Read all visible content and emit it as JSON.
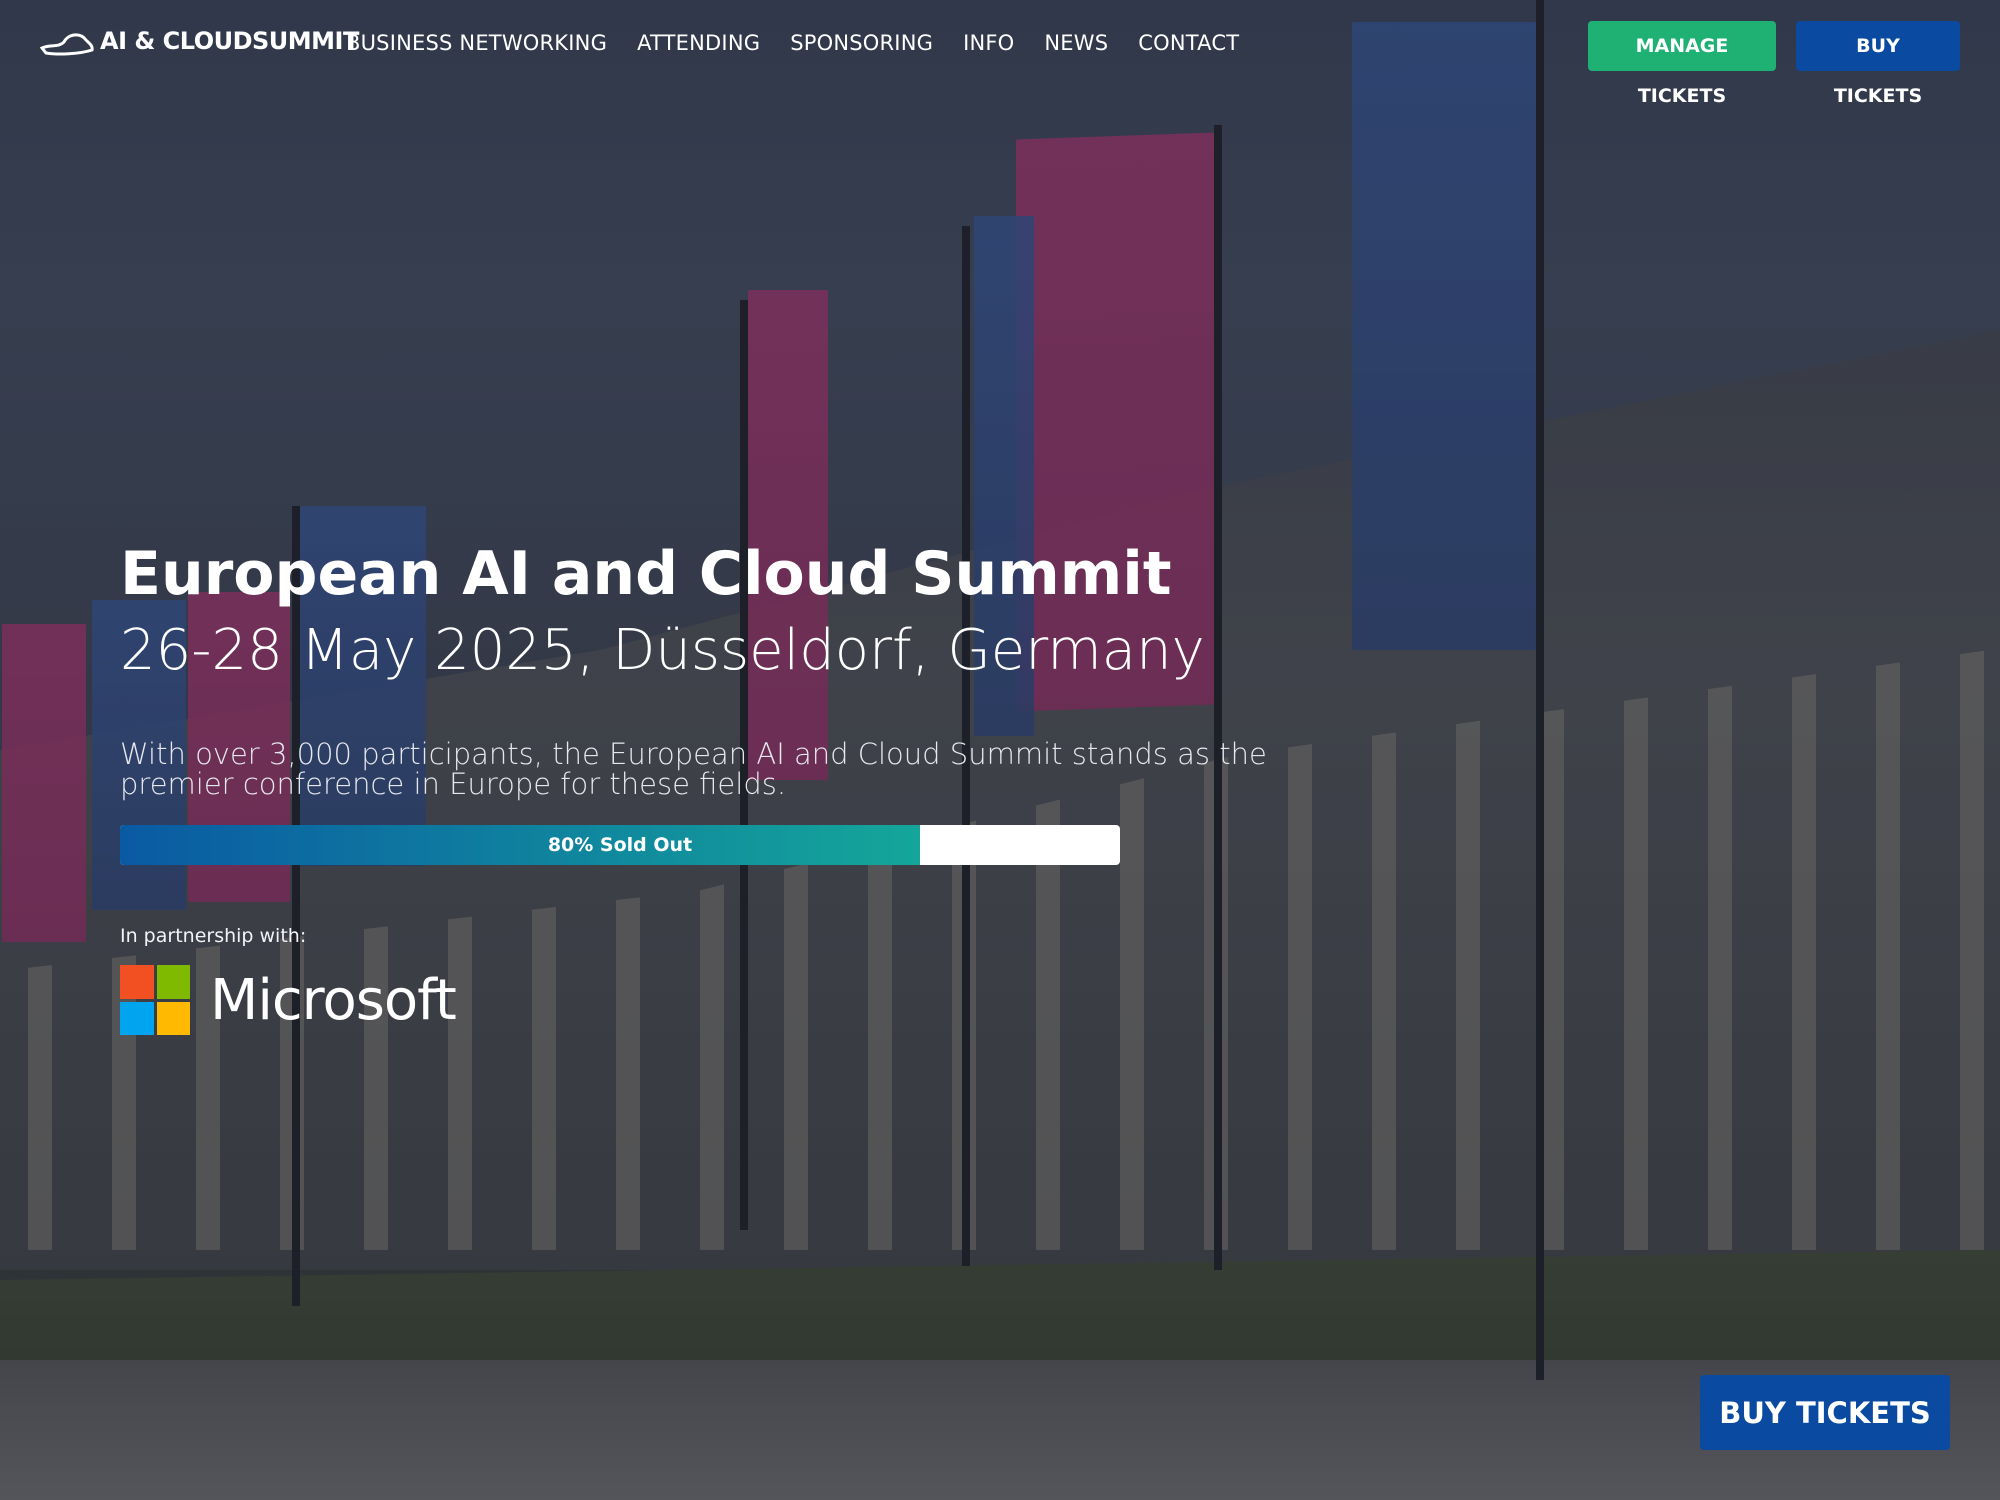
{
  "header": {
    "logo_text": "AI & CLOUDSUMMIT",
    "nav": [
      {
        "label": "BUSINESS NETWORKING"
      },
      {
        "label": "ATTENDING"
      },
      {
        "label": "SPONSORING"
      },
      {
        "label": "INFO"
      },
      {
        "label": "NEWS"
      },
      {
        "label": "CONTACT"
      }
    ],
    "manage_tickets_label": "MANAGE TICKETS",
    "buy_tickets_label": "BUY TICKETS"
  },
  "hero": {
    "title": "European AI and Cloud Summit",
    "subtitle": "26-28 May 2025, Düsseldorf, Germany",
    "description": "With over 3,000 participants, the European AI and Cloud Summit stands as the premier conference in Europe for these fields.",
    "progress": {
      "label": "80% Sold Out",
      "percent": 80
    },
    "partner_label": "In partnership with:",
    "partner_name": "Microsoft"
  },
  "floating_buy_tickets_label": "BUY TICKETS",
  "colors": {
    "manage_button": "#1fb074",
    "buy_button": "#0b4aa1",
    "progress_start": "#0a5aa3",
    "progress_end": "#14a69a"
  },
  "icons": {
    "logo": "cloud-logo-icon",
    "partner": "microsoft-logo-icon"
  }
}
